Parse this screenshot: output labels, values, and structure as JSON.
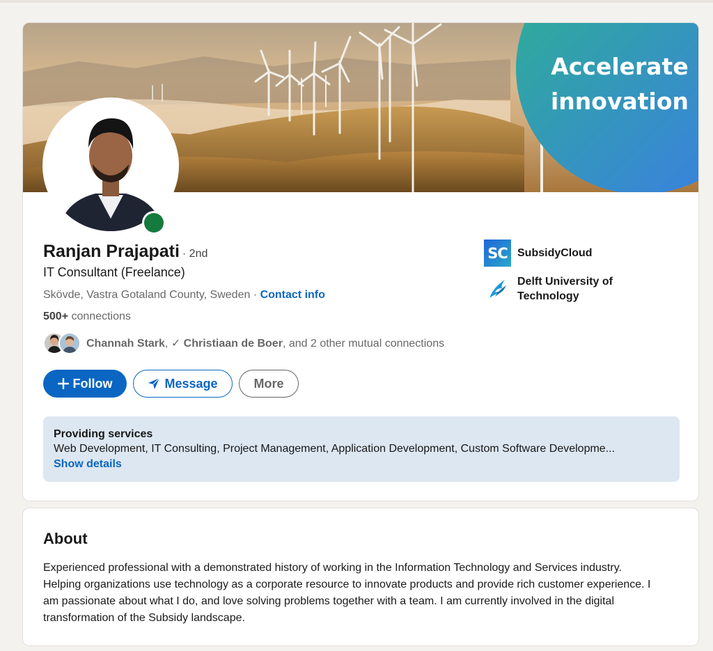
{
  "colors": {
    "page_bg": "#f4f2ee",
    "brand_blue": "#0a66c2",
    "online_green": "#147a3e",
    "services_bg": "#dde7f1",
    "banner_circle_from": "#2db28f",
    "banner_circle_to": "#3b7be8"
  },
  "banner": {
    "headline_line1": "Accelerate",
    "headline_line2": "innovation"
  },
  "profile": {
    "name": "Ranjan Prajapati",
    "degree": "· 2nd",
    "headline": "IT Consultant (Freelance)",
    "location": "Skövde, Vastra Gotaland County, Sweden",
    "separator": " · ",
    "contact_info": "Contact info",
    "connections_count": "500+",
    "connections_label": " connections",
    "online": true
  },
  "mutual": {
    "first": "Channah Stark",
    "comma": ",",
    "check": " ✓ ",
    "second": "Christiaan de Boer",
    "rest": ", and 2 other mutual connections"
  },
  "actions": {
    "follow_icon": "plus-icon",
    "follow_label": "Follow",
    "message_icon": "send-icon",
    "message_label": "Message",
    "more_label": "More"
  },
  "services": {
    "title": "Providing services",
    "list": "Web Development, IT Consulting, Project Management, Application Development, Custom Software Developme...",
    "link": "Show details"
  },
  "organizations": [
    {
      "logo_text": "SC",
      "logo_icon": "subsidycloud-logo",
      "name": "SubsidyCloud"
    },
    {
      "logo_icon": "delft-flame-logo",
      "name_line1": "Delft University of",
      "name_line2": "Technology"
    }
  ],
  "about": {
    "title": "About",
    "body": "Experienced professional with a demonstrated history of working in the Information Technology and Services industry. Helping organizations use technology as a corporate resource to innovate products and provide rich customer experience. I am passionate about what I do, and love solving problems together with a team. I am currently involved in the digital transformation of the Subsidy landscape."
  }
}
